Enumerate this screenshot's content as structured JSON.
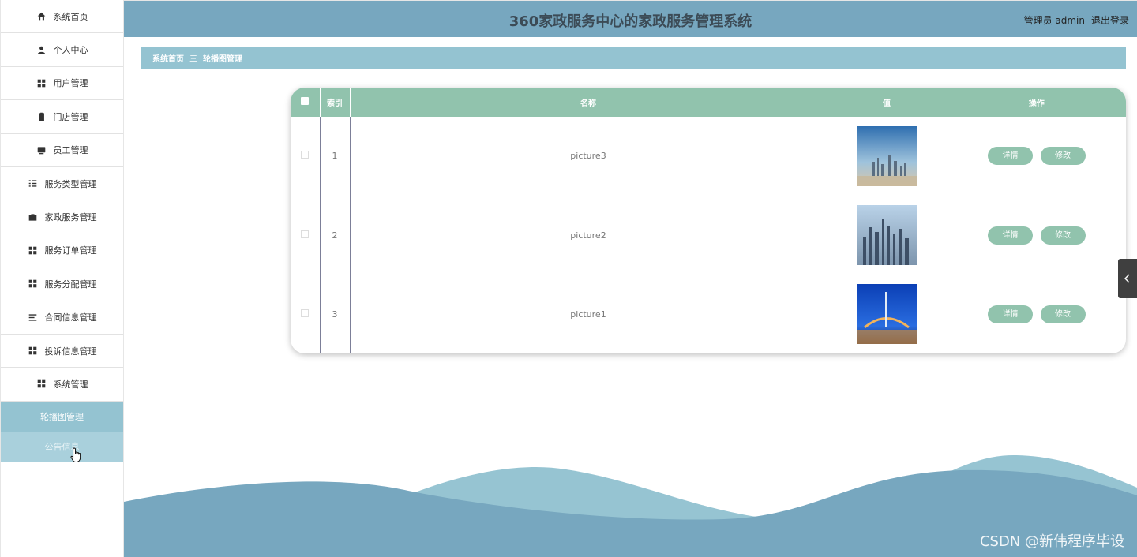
{
  "header": {
    "title": "360家政服务中心的家政服务管理系统",
    "user": "管理员 admin",
    "logout": "退出登录"
  },
  "sidebar": {
    "items": [
      {
        "label": "系统首页",
        "icon": "home-icon"
      },
      {
        "label": "个人中心",
        "icon": "user-icon"
      },
      {
        "label": "用户管理",
        "icon": "grid-icon"
      },
      {
        "label": "门店管理",
        "icon": "clipboard-icon"
      },
      {
        "label": "员工管理",
        "icon": "monitor-icon"
      },
      {
        "label": "服务类型管理",
        "icon": "list-icon"
      },
      {
        "label": "家政服务管理",
        "icon": "briefcase-icon"
      },
      {
        "label": "服务订单管理",
        "icon": "grid-icon"
      },
      {
        "label": "服务分配管理",
        "icon": "grid-icon"
      },
      {
        "label": "合同信息管理",
        "icon": "menu-icon"
      },
      {
        "label": "投诉信息管理",
        "icon": "grid-icon"
      },
      {
        "label": "系统管理",
        "icon": "grid-icon"
      }
    ],
    "subitems": [
      {
        "label": "轮播图管理"
      },
      {
        "label": "公告信息"
      }
    ]
  },
  "breadcrumb": {
    "home": "系统首页",
    "separator": "三",
    "current": "轮播图管理"
  },
  "table": {
    "columns": [
      "索引",
      "名称",
      "值",
      "操作"
    ],
    "rows": [
      {
        "index": "1",
        "name": "picture3"
      },
      {
        "index": "2",
        "name": "picture2"
      },
      {
        "index": "3",
        "name": "picture1"
      }
    ],
    "actions": {
      "detail": "详情",
      "edit": "修改"
    }
  },
  "watermark": "CSDN @新伟程序毕设",
  "colors": {
    "header": "#77a7bf",
    "breadcrumb": "#94c3d1",
    "table_header": "#91c3ad",
    "button": "#91c3ad"
  }
}
